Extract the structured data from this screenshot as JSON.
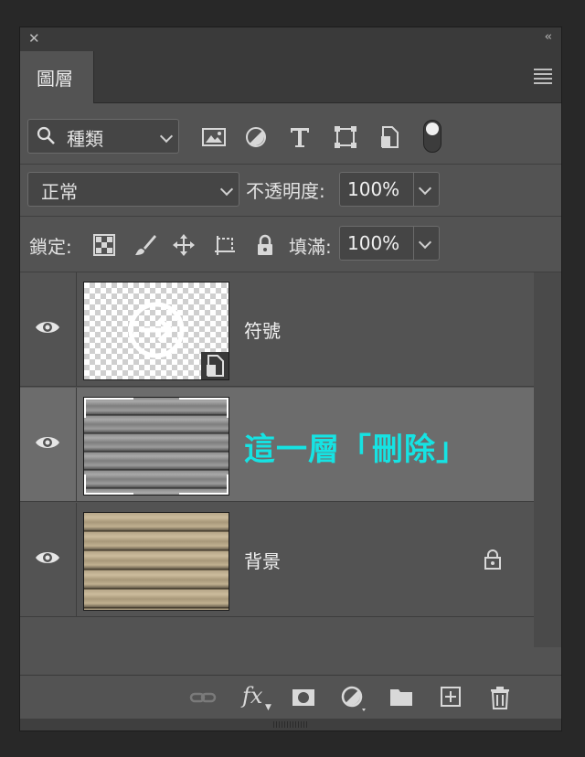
{
  "panel": {
    "tab_label": "圖層"
  },
  "filter": {
    "kind_label": "種類",
    "icons": [
      "image-filter-icon",
      "adjustment-filter-icon",
      "type-filter-icon",
      "shape-filter-icon",
      "smart-object-filter-icon",
      "filter-toggle"
    ]
  },
  "blend": {
    "mode": "正常",
    "opacity_label": "不透明度:",
    "opacity_value": "100%"
  },
  "lock": {
    "label": "鎖定:",
    "fill_label": "填滿:",
    "fill_value": "100%"
  },
  "layers": [
    {
      "name": "符號",
      "visible": true,
      "type": "smart-object"
    },
    {
      "name": "這一層「刪除」",
      "visible": true,
      "selected": true
    },
    {
      "name": "背景",
      "visible": true,
      "locked": true
    }
  ],
  "colors": {
    "panel_bg": "#535353",
    "selected_row": "#6c6c6c",
    "annotation_text": "#16e3e3"
  },
  "bottom_icons": [
    "link-layers-icon",
    "fx-icon",
    "layer-mask-icon",
    "adjustment-layer-icon",
    "group-folder-icon",
    "new-layer-icon",
    "trash-icon"
  ],
  "bottom_labels": {
    "fx": "fx"
  }
}
